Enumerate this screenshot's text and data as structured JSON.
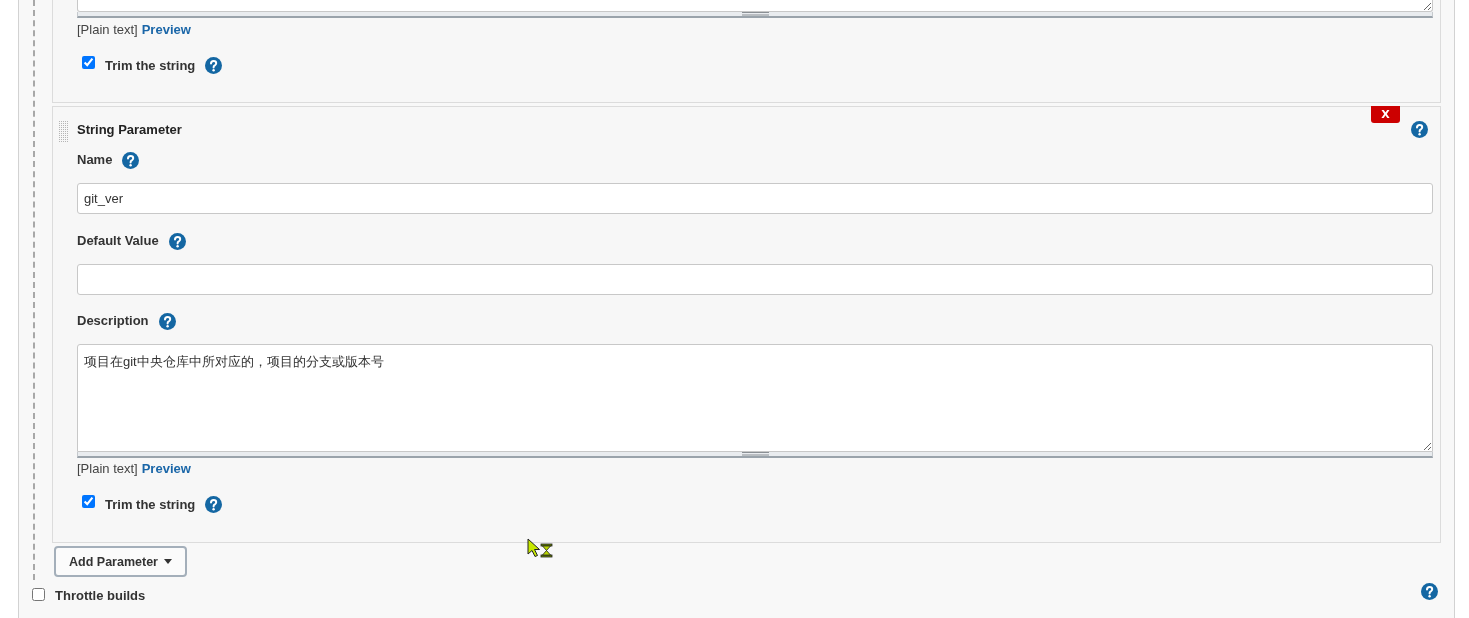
{
  "parameters": [
    {
      "clipped": true,
      "description_format": "[Plain text]",
      "preview_link": "Preview",
      "trim": {
        "label": "Trim the string",
        "checked": true
      }
    },
    {
      "clipped": false,
      "title": "String Parameter",
      "delete_button": "X",
      "fields": [
        {
          "kind": "text",
          "label": "Name",
          "value": "git_ver"
        },
        {
          "kind": "text",
          "label": "Default Value"
        },
        {
          "kind": "textarea",
          "label": "Description",
          "value": "项目在git中央仓库中所对应的，项目的分支或版本号"
        }
      ],
      "description_format": "[Plain text]",
      "preview_link": "Preview",
      "trim": {
        "label": "Trim the string",
        "checked": true
      }
    }
  ],
  "add_parameter_button": "Add Parameter",
  "throttle_builds": {
    "label": "Throttle builds",
    "checked": false
  }
}
